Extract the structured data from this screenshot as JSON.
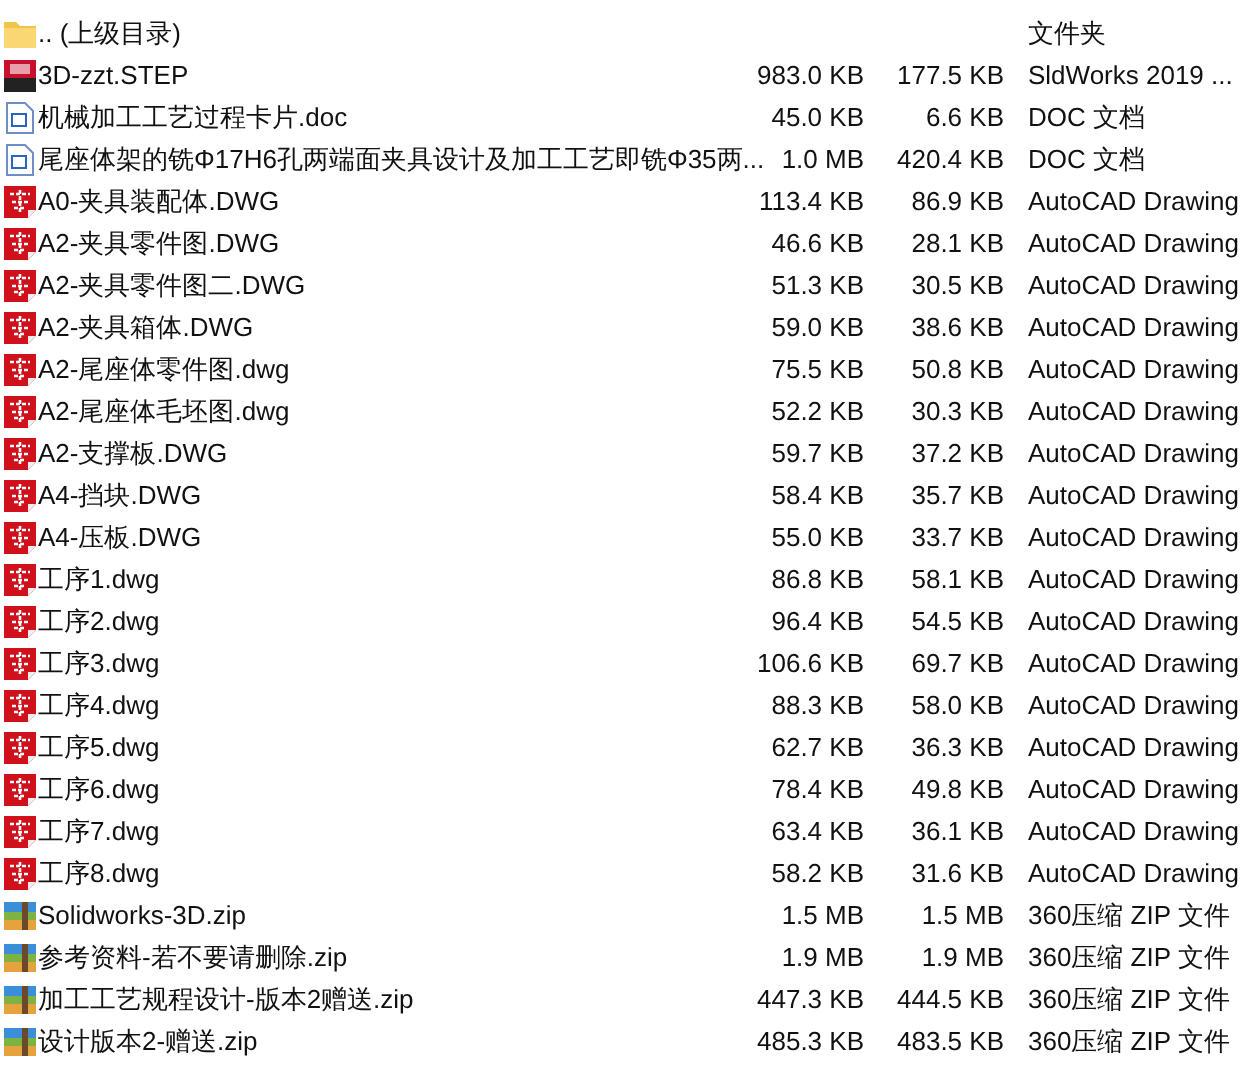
{
  "files": [
    {
      "kind": "folder",
      "name": ".. (上级目录)",
      "type": "文件夹"
    },
    {
      "kind": "solidworks",
      "name": "3D-zzt.STEP",
      "size": "983.0 KB",
      "packed": "177.5 KB",
      "type": "SldWorks 2019 ..."
    },
    {
      "kind": "doc",
      "name": "机械加工工艺过程卡片.doc",
      "size": "45.0 KB",
      "packed": "6.6 KB",
      "type": "DOC 文档"
    },
    {
      "kind": "doc",
      "name": "尾座体架的铣Φ17H6孔两端面夹具设计及加工工艺即铣Φ35两...",
      "size": "1.0 MB",
      "packed": "420.4 KB",
      "type": "DOC 文档"
    },
    {
      "kind": "dwg",
      "name": "A0-夹具装配体.DWG",
      "size": "113.4 KB",
      "packed": "86.9 KB",
      "type": "AutoCAD Drawing"
    },
    {
      "kind": "dwg",
      "name": "A2-夹具零件图.DWG",
      "size": "46.6 KB",
      "packed": "28.1 KB",
      "type": "AutoCAD Drawing"
    },
    {
      "kind": "dwg",
      "name": "A2-夹具零件图二.DWG",
      "size": "51.3 KB",
      "packed": "30.5 KB",
      "type": "AutoCAD Drawing"
    },
    {
      "kind": "dwg",
      "name": "A2-夹具箱体.DWG",
      "size": "59.0 KB",
      "packed": "38.6 KB",
      "type": "AutoCAD Drawing"
    },
    {
      "kind": "dwg",
      "name": "A2-尾座体零件图.dwg",
      "size": "75.5 KB",
      "packed": "50.8 KB",
      "type": "AutoCAD Drawing"
    },
    {
      "kind": "dwg",
      "name": "A2-尾座体毛坯图.dwg",
      "size": "52.2 KB",
      "packed": "30.3 KB",
      "type": "AutoCAD Drawing"
    },
    {
      "kind": "dwg",
      "name": "A2-支撑板.DWG",
      "size": "59.7 KB",
      "packed": "37.2 KB",
      "type": "AutoCAD Drawing"
    },
    {
      "kind": "dwg",
      "name": "A4-挡块.DWG",
      "size": "58.4 KB",
      "packed": "35.7 KB",
      "type": "AutoCAD Drawing"
    },
    {
      "kind": "dwg",
      "name": "A4-压板.DWG",
      "size": "55.0 KB",
      "packed": "33.7 KB",
      "type": "AutoCAD Drawing"
    },
    {
      "kind": "dwg",
      "name": "工序1.dwg",
      "size": "86.8 KB",
      "packed": "58.1 KB",
      "type": "AutoCAD Drawing"
    },
    {
      "kind": "dwg",
      "name": "工序2.dwg",
      "size": "96.4 KB",
      "packed": "54.5 KB",
      "type": "AutoCAD Drawing"
    },
    {
      "kind": "dwg",
      "name": "工序3.dwg",
      "size": "106.6 KB",
      "packed": "69.7 KB",
      "type": "AutoCAD Drawing"
    },
    {
      "kind": "dwg",
      "name": "工序4.dwg",
      "size": "88.3 KB",
      "packed": "58.0 KB",
      "type": "AutoCAD Drawing"
    },
    {
      "kind": "dwg",
      "name": "工序5.dwg",
      "size": "62.7 KB",
      "packed": "36.3 KB",
      "type": "AutoCAD Drawing"
    },
    {
      "kind": "dwg",
      "name": "工序6.dwg",
      "size": "78.4 KB",
      "packed": "49.8 KB",
      "type": "AutoCAD Drawing"
    },
    {
      "kind": "dwg",
      "name": "工序7.dwg",
      "size": "63.4 KB",
      "packed": "36.1 KB",
      "type": "AutoCAD Drawing"
    },
    {
      "kind": "dwg",
      "name": "工序8.dwg",
      "size": "58.2 KB",
      "packed": "31.6 KB",
      "type": "AutoCAD Drawing"
    },
    {
      "kind": "zip",
      "name": "Solidworks-3D.zip",
      "size": "1.5 MB",
      "packed": "1.5 MB",
      "type": "360压缩 ZIP 文件"
    },
    {
      "kind": "zip",
      "name": "参考资料-若不要请删除.zip",
      "size": "1.9 MB",
      "packed": "1.9 MB",
      "type": "360压缩 ZIP 文件"
    },
    {
      "kind": "zip",
      "name": "加工工艺规程设计-版本2赠送.zip",
      "size": "447.3 KB",
      "packed": "444.5 KB",
      "type": "360压缩 ZIP 文件"
    },
    {
      "kind": "zip",
      "name": "设计版本2-赠送.zip",
      "size": "485.3 KB",
      "packed": "483.5 KB",
      "type": "360压缩 ZIP 文件"
    }
  ]
}
